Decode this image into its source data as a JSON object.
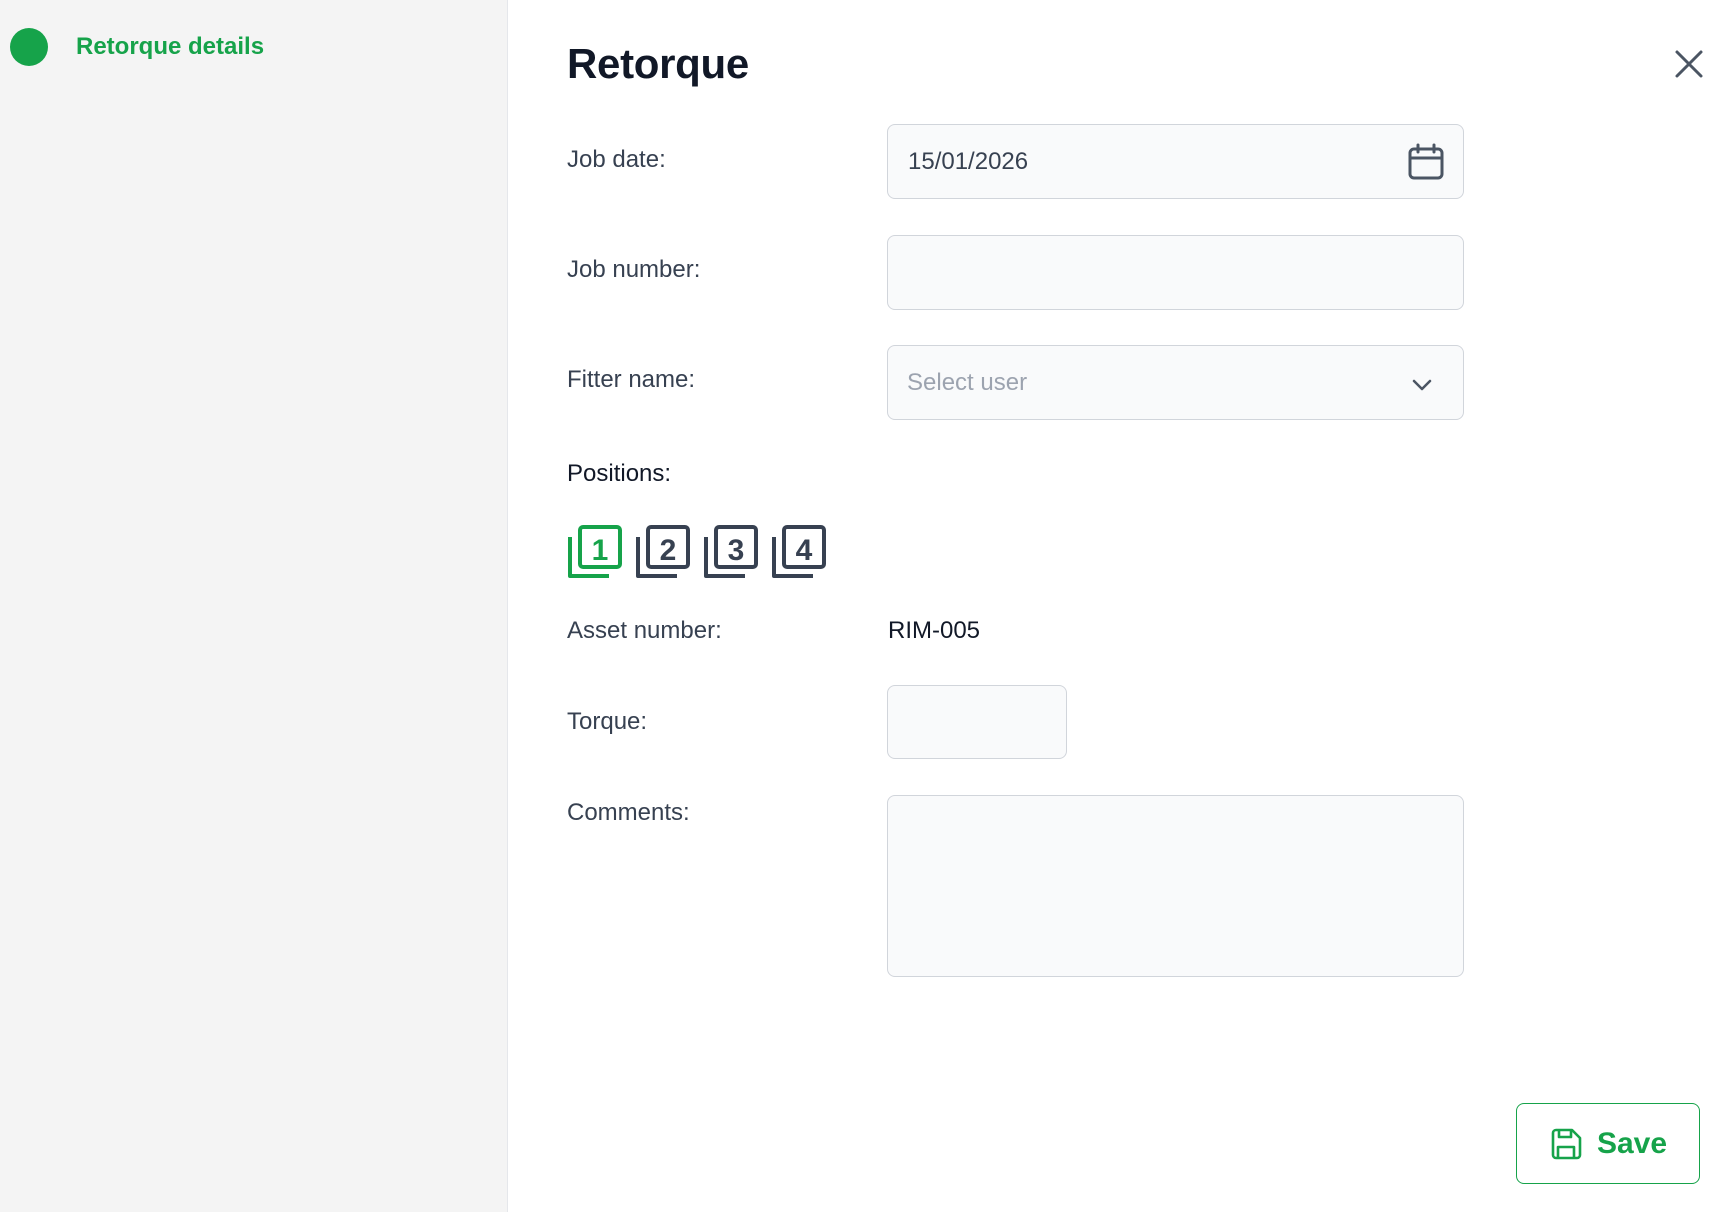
{
  "sidebar": {
    "steps": [
      {
        "label": "Retorque details",
        "state": "active"
      }
    ]
  },
  "form": {
    "title": "Retorque",
    "job_date": {
      "label": "Job date:",
      "value": "15/01/2026"
    },
    "job_number": {
      "label": "Job number:",
      "value": ""
    },
    "fitter_name": {
      "label": "Fitter name:",
      "placeholder": "Select user"
    },
    "positions": {
      "label": "Positions:",
      "items": [
        {
          "number": "1",
          "selected": true
        },
        {
          "number": "2",
          "selected": false
        },
        {
          "number": "3",
          "selected": false
        },
        {
          "number": "4",
          "selected": false
        }
      ]
    },
    "asset_number": {
      "label": "Asset number:",
      "value": "RIM-005"
    },
    "torque": {
      "label": "Torque:",
      "value": ""
    },
    "comments": {
      "label": "Comments:",
      "value": ""
    },
    "save_label": "Save"
  },
  "icons": {
    "close": "close-icon",
    "calendar": "calendar-icon",
    "dropdown": "chevron-down-icon",
    "save": "save-icon"
  },
  "colors": {
    "accent": "#16a34a",
    "sidebar_bg": "#f4f4f4",
    "field_bg": "#f9fafb",
    "field_border": "#d1d5db",
    "inactive_icon": "#374151"
  }
}
